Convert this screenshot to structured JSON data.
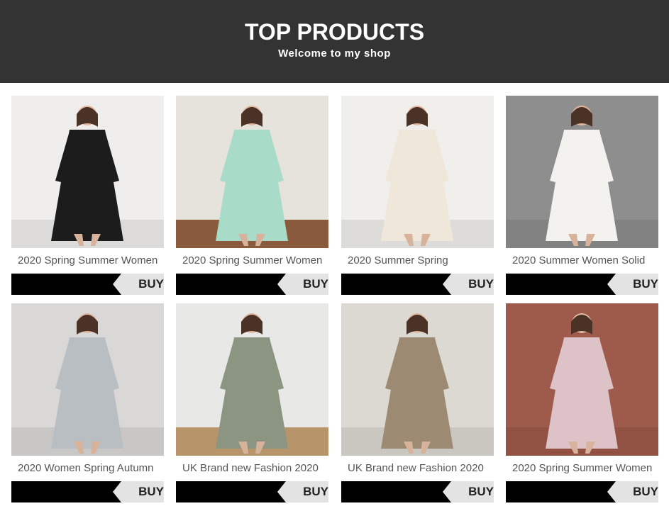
{
  "header": {
    "title": "TOP PRODUCTS",
    "subtitle": "Welcome to my shop"
  },
  "products": [
    {
      "title": "2020 Spring Summer Women",
      "buy_label": "BUY",
      "image": "black-lace-dress",
      "bg": "#f0eeec",
      "garment": "#1c1c1c"
    },
    {
      "title": "2020 Spring Summer Women",
      "buy_label": "BUY",
      "image": "mint-shirt-dress",
      "bg": "#e6e2dc",
      "garment": "#a8dcc8"
    },
    {
      "title": "2020 Summer Spring",
      "buy_label": "BUY",
      "image": "cream-wide-pants",
      "bg": "#f1efec",
      "garment": "#efe7da"
    },
    {
      "title": "2020 Summer Women Solid",
      "buy_label": "BUY",
      "image": "white-sleeveless-dress",
      "bg": "#8e8e8e",
      "garment": "#f4f2ee"
    },
    {
      "title": "2020 Women Spring Autumn",
      "buy_label": "BUY",
      "image": "grey-blazer-outfit",
      "bg": "#d9d8d6",
      "garment": "#b9bec2"
    },
    {
      "title": "UK Brand new Fashion 2020",
      "buy_label": "BUY",
      "image": "olive-trench-coat",
      "bg": "#e8e8e6",
      "garment": "#8c9582"
    },
    {
      "title": "UK Brand new Fashion 2020",
      "buy_label": "BUY",
      "image": "beige-trench-coat",
      "bg": "#dcd8d2",
      "garment": "#9c8a72"
    },
    {
      "title": "2020 Spring Summer Women",
      "buy_label": "BUY",
      "image": "floral-print-dress",
      "bg": "#9e5a4a",
      "garment": "#ddc2c8"
    }
  ]
}
